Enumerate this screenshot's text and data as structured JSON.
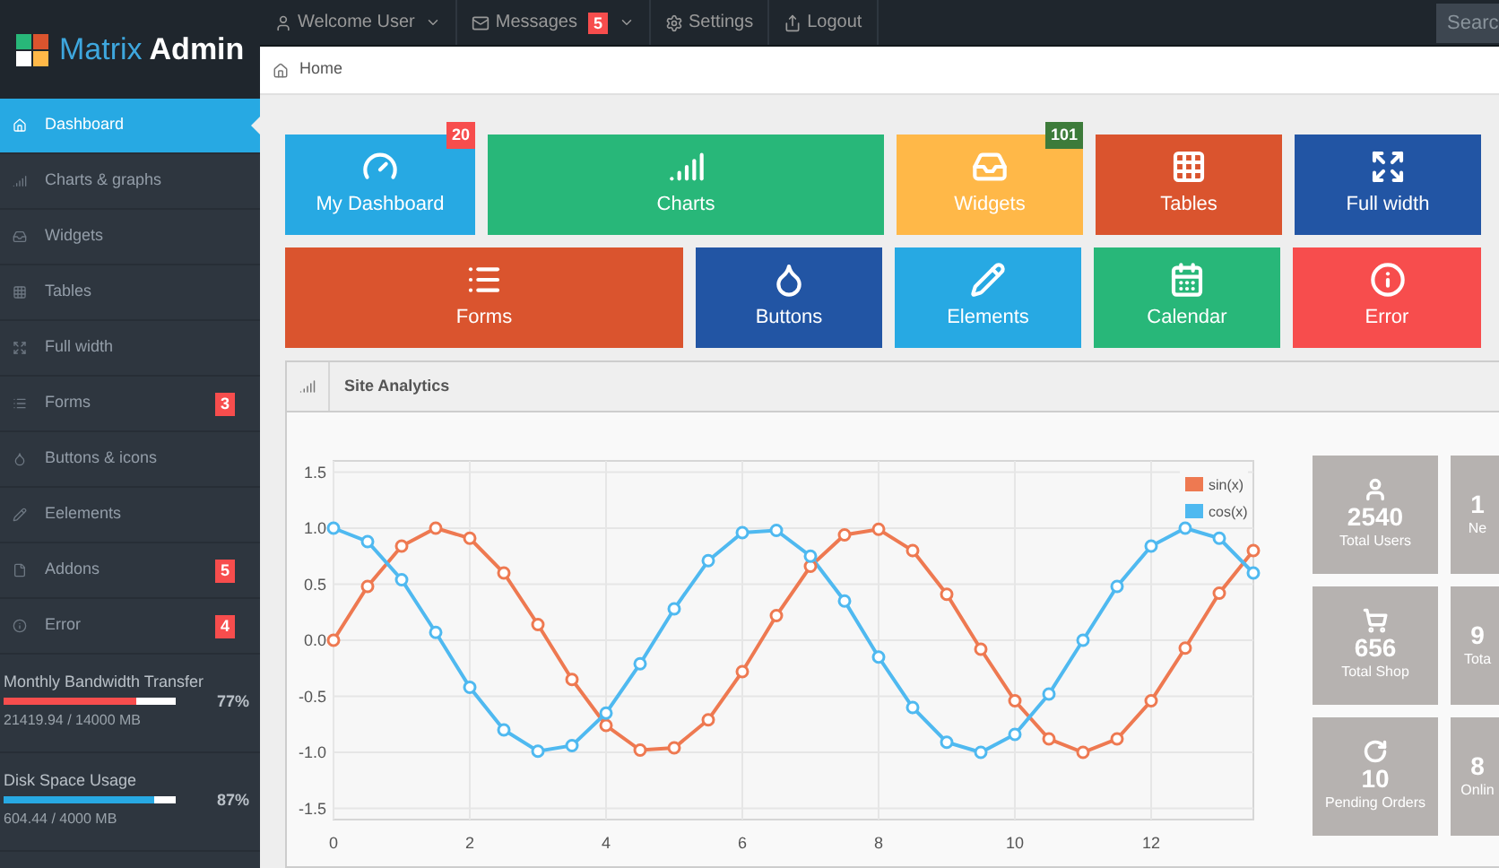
{
  "logo": {
    "word_1": "Matrix",
    "word_2": "Admin"
  },
  "top_nav": [
    {
      "kind": "user",
      "label": "Welcome User",
      "caret": true
    },
    {
      "kind": "mail",
      "label": "Messages",
      "badge": "5",
      "caret": true
    },
    {
      "kind": "gear",
      "label": "Settings",
      "caret": false
    },
    {
      "kind": "share",
      "label": "Logout",
      "caret": false
    }
  ],
  "search": {
    "placeholder": "Searc"
  },
  "breadcrumb": [
    {
      "kind": "home",
      "label": "Home"
    }
  ],
  "sidebar": {
    "items": [
      {
        "kind": "home",
        "label": "Dashboard",
        "selected": true
      },
      {
        "kind": "signal",
        "label": "Charts & graphs",
        "selected": false
      },
      {
        "kind": "inbox",
        "label": "Widgets",
        "selected": false
      },
      {
        "kind": "grid",
        "label": "Tables",
        "selected": false
      },
      {
        "kind": "expand",
        "label": "Full width",
        "selected": false
      },
      {
        "kind": "list",
        "label": "Forms",
        "selected": false,
        "badge": "3"
      },
      {
        "kind": "drop",
        "label": "Buttons & icons",
        "selected": false
      },
      {
        "kind": "pencil",
        "label": "Eelements",
        "selected": false
      },
      {
        "kind": "file",
        "label": "Addons",
        "selected": false,
        "badge": "5"
      },
      {
        "kind": "info",
        "label": "Error",
        "selected": false,
        "badge": "4"
      }
    ],
    "meters": [
      {
        "title": "Monthly Bandwidth Transfer",
        "level": 0.77,
        "color": "#f74d4d",
        "reading": "21419.94 / 14000 MB",
        "percent": "77%"
      },
      {
        "title": "Disk Space Usage",
        "level": 0.87,
        "color": "#27a9e3",
        "reading": "604.44 / 4000 MB",
        "percent": "87%"
      }
    ]
  },
  "tiles": [
    [
      {
        "kind": "gauge",
        "label": "My Dashboard",
        "color": "#27a9e3",
        "badge": {
          "text": "20",
          "color": "#f74d4d"
        }
      },
      {
        "kind": "signal",
        "label": "Charts",
        "color": "#28b779"
      },
      {
        "kind": "inbox",
        "label": "Widgets",
        "color": "#ffb848",
        "badge": {
          "text": "101",
          "color": "#3d7b3a"
        }
      },
      {
        "kind": "grid",
        "label": "Tables",
        "color": "#da542e"
      },
      {
        "kind": "expand",
        "label": "Full width",
        "color": "#2255a4"
      }
    ],
    [
      {
        "kind": "list",
        "label": "Forms",
        "color": "#da542e"
      },
      {
        "kind": "drop",
        "label": "Buttons",
        "color": "#2255a4"
      },
      {
        "kind": "pencil",
        "label": "Elements",
        "color": "#27a9e3"
      },
      {
        "kind": "calendar",
        "label": "Calendar",
        "color": "#28b779"
      },
      {
        "kind": "info",
        "label": "Error",
        "color": "#f74d4d"
      }
    ]
  ],
  "analytics": {
    "title": "Site Analytics",
    "chart_data": {
      "type": "line",
      "grid": true,
      "legend": true,
      "x": [
        0,
        0.5,
        1,
        1.5,
        2,
        2.5,
        3,
        3.5,
        4,
        4.5,
        5,
        5.5,
        6,
        6.5,
        7,
        7.5,
        8,
        8.5,
        9,
        9.5,
        10,
        10.5,
        11,
        11.5,
        12,
        12.5,
        13,
        13.5
      ],
      "series": [
        {
          "name": "sin(x)",
          "color": "#ee7951",
          "marker": "circle",
          "values": [
            0,
            0.48,
            0.84,
            1.0,
            0.91,
            0.6,
            0.14,
            -0.35,
            -0.76,
            -0.98,
            -0.96,
            -0.71,
            -0.28,
            0.22,
            0.66,
            0.94,
            0.99,
            0.8,
            0.41,
            -0.08,
            -0.54,
            -0.88,
            -1.0,
            -0.88,
            -0.54,
            -0.07,
            0.42,
            0.8
          ]
        },
        {
          "name": "cos(x)",
          "color": "#4fb9f0",
          "marker": "circle",
          "values": [
            1.0,
            0.88,
            0.54,
            0.07,
            -0.42,
            -0.8,
            -0.99,
            -0.94,
            -0.65,
            -0.21,
            0.28,
            0.71,
            0.96,
            0.98,
            0.75,
            0.35,
            -0.15,
            -0.6,
            -0.91,
            -1.0,
            -0.84,
            -0.48,
            0.0,
            0.48,
            0.84,
            1.0,
            0.91,
            0.6
          ]
        }
      ],
      "xlim": [
        0,
        13.5
      ],
      "ylim": [
        -1.6,
        1.6
      ],
      "xticks": [
        0,
        2,
        4,
        6,
        8,
        10,
        12
      ],
      "yticks": [
        {
          "value": 1.5,
          "label": "1.5"
        },
        {
          "value": 1,
          "label": "1.0"
        },
        {
          "value": 0.5,
          "label": "0.5"
        },
        {
          "value": 0,
          "label": "0.0"
        },
        {
          "value": -0.5,
          "label": "-0.5"
        },
        {
          "value": -1,
          "label": "-1.0"
        },
        {
          "value": -1.5,
          "label": "-1.5"
        }
      ]
    },
    "stats": [
      [
        {
          "kind": "user",
          "value": "2540",
          "label": "Total Users"
        },
        {
          "value": "1",
          "label": "Ne"
        }
      ],
      [
        {
          "kind": "cart",
          "value": "656",
          "label": "Total Shop"
        },
        {
          "value": "9",
          "label": "Tota"
        }
      ],
      [
        {
          "kind": "refresh",
          "value": "10",
          "label": "Pending Orders"
        },
        {
          "value": "8",
          "label": "Onlin"
        }
      ]
    ]
  }
}
